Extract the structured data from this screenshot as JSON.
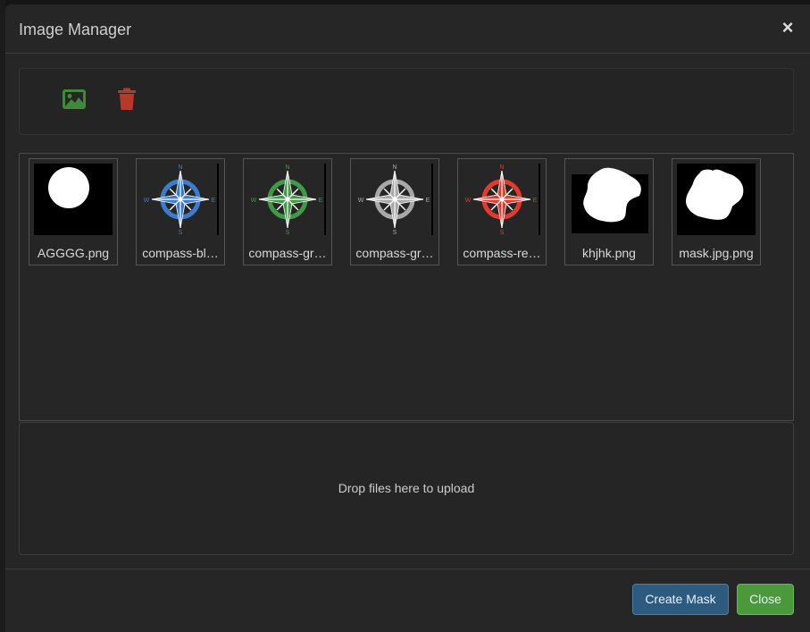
{
  "modal": {
    "title": "Image Manager",
    "close_symbol": "×"
  },
  "toolbar": {
    "upload_icon": "image-icon",
    "delete_icon": "trash-icon",
    "upload_color": "#4a9a3c",
    "delete_color": "#c0392b"
  },
  "images": [
    {
      "name": "AGGGG.png",
      "kind": "circle-mask"
    },
    {
      "name": "compass-bl…",
      "kind": "compass",
      "color": "#3a7dd0"
    },
    {
      "name": "compass-gr…",
      "kind": "compass",
      "color": "#3f9a48"
    },
    {
      "name": "compass-gr…",
      "kind": "compass",
      "color": "#a8a8a8"
    },
    {
      "name": "compass-re…",
      "kind": "compass",
      "color": "#e23a2c"
    },
    {
      "name": "khjhk.png",
      "kind": "blob-mask"
    },
    {
      "name": "mask.jpg.png",
      "kind": "blob-mask-2"
    }
  ],
  "compass_letters": {
    "n": "N",
    "s": "S",
    "e": "E",
    "w": "W"
  },
  "dropzone": {
    "text": "Drop files here to upload"
  },
  "footer": {
    "create_mask_label": "Create Mask",
    "close_label": "Close"
  }
}
